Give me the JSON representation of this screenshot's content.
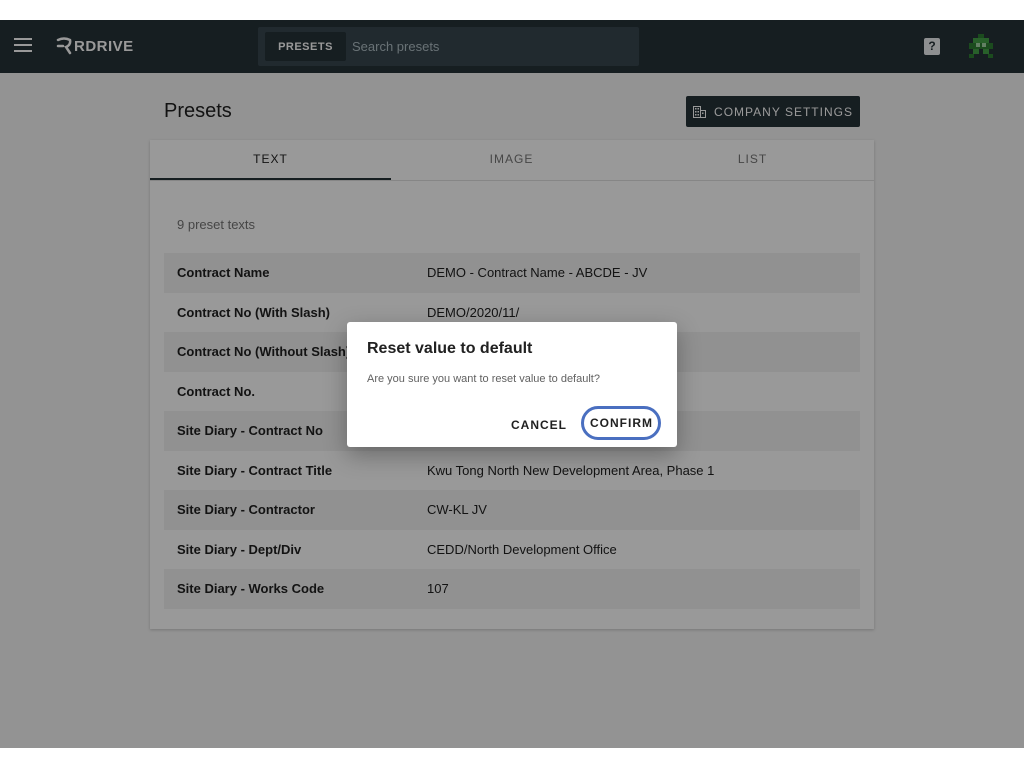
{
  "header": {
    "logo_text": "RDRIVE",
    "search_button": "PRESETS",
    "search_placeholder": "Search presets",
    "help_icon_label": "?",
    "icons": [
      "menu-icon",
      "logo-icon",
      "help-icon",
      "avatar-icon"
    ]
  },
  "page": {
    "title": "Presets",
    "company_settings_label": "COMPANY SETTINGS"
  },
  "tabs": [
    {
      "label": "TEXT",
      "active": true
    },
    {
      "label": "IMAGE",
      "active": false
    },
    {
      "label": "LIST",
      "active": false
    }
  ],
  "presets": {
    "count_text": "9 preset texts",
    "rows": [
      {
        "name": "Contract Name",
        "value": "DEMO - Contract Name - ABCDE - JV"
      },
      {
        "name": "Contract No (With Slash)",
        "value": "DEMO/2020/11/"
      },
      {
        "name": "Contract No (Without Slash)",
        "value": ""
      },
      {
        "name": "Contract No.",
        "value": ""
      },
      {
        "name": "Site Diary - Contract No",
        "value": ""
      },
      {
        "name": "Site Diary - Contract Title",
        "value": "Kwu Tong North New Development Area, Phase 1"
      },
      {
        "name": "Site Diary - Contractor",
        "value": "CW-KL JV"
      },
      {
        "name": "Site Diary - Dept/Div",
        "value": "CEDD/North Development Office"
      },
      {
        "name": "Site Diary - Works Code",
        "value": "107"
      }
    ]
  },
  "dialog": {
    "title": "Reset value to default",
    "message": "Are you sure you want to reset value to default?",
    "cancel_label": "CANCEL",
    "confirm_label": "CONFIRM"
  },
  "colors": {
    "topbar": "#263238",
    "search_bg": "#37474f",
    "highlight": "#4a6fc0",
    "avatar_green": "#2e7d32"
  }
}
